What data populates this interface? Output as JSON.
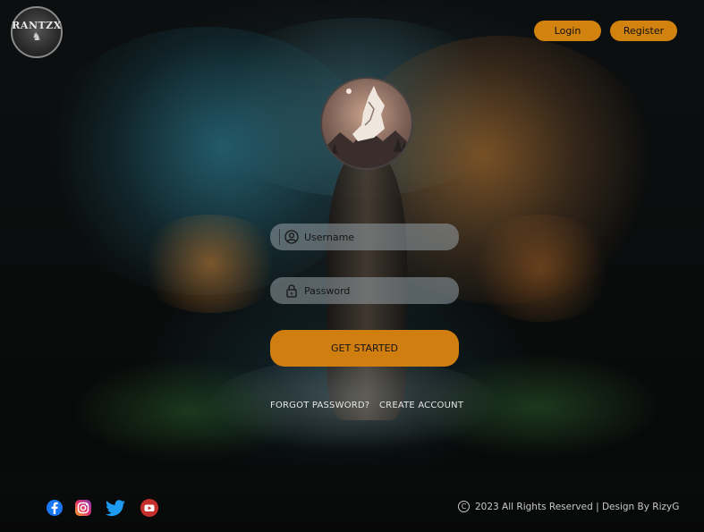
{
  "brand": {
    "logo_text": "RANTZX"
  },
  "header": {
    "login_label": "Login",
    "register_label": "Register"
  },
  "form": {
    "username_placeholder": "Username",
    "password_placeholder": "Password",
    "submit_label": "GET STARTED",
    "forgot_label": "FORGOT PASSWORD?",
    "create_label": "CREATE ACCOUNT"
  },
  "footer": {
    "socials": [
      "facebook-icon",
      "instagram-icon",
      "twitter-icon",
      "youtube-icon"
    ],
    "copyright": "2023 All Rights Reserved | Design By RizyG"
  },
  "colors": {
    "accent": "#d2830f",
    "field_bg": "#969fa5",
    "background": "#0b0d0e",
    "facebook": "#1877f2",
    "twitter": "#1d9bf0",
    "youtube": "#c4302b"
  }
}
